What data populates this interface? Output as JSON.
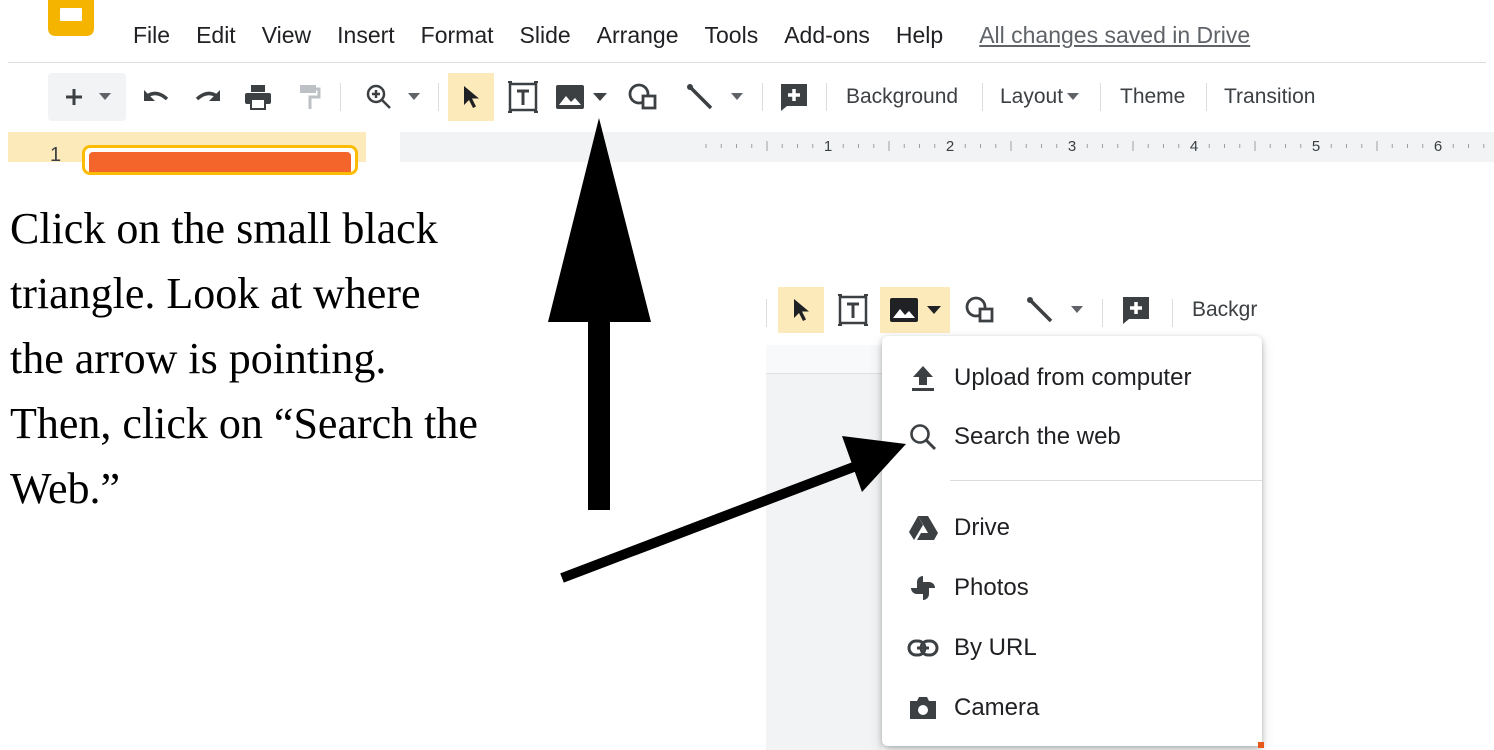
{
  "menu": {
    "items": [
      "File",
      "Edit",
      "View",
      "Insert",
      "Format",
      "Slide",
      "Arrange",
      "Tools",
      "Add-ons",
      "Help"
    ],
    "save_status": "All changes saved in Drive"
  },
  "toolbar": {
    "background_label": "Background",
    "layout_label": "Layout",
    "theme_label": "Theme",
    "transition_label": "Transition"
  },
  "ruler": {
    "marks": [
      "1",
      "2",
      "3",
      "4",
      "5",
      "6"
    ]
  },
  "filmstrip": {
    "slide_number": "1"
  },
  "instruction": {
    "lines": [
      "Click on the small black",
      "triangle. Look at where",
      "the arrow is pointing.",
      "Then, click on “Search the",
      "Web.”"
    ]
  },
  "zoom_toolbar": {
    "background_label_partial": "Backgr"
  },
  "image_menu": {
    "items": [
      {
        "label": "Upload from computer",
        "icon": "upload-icon"
      },
      {
        "label": "Search the web",
        "icon": "search-icon"
      },
      {
        "label": "Drive",
        "icon": "drive-icon"
      },
      {
        "label": "Photos",
        "icon": "photos-icon"
      },
      {
        "label": "By URL",
        "icon": "link-icon"
      },
      {
        "label": "Camera",
        "icon": "camera-icon"
      }
    ]
  },
  "colors": {
    "active_tool": "#fdeaba",
    "slides_brand": "#f4b400",
    "slide_thumb": "#f4652c",
    "icon_gray": "#5f6368",
    "annotation": "#000000"
  }
}
